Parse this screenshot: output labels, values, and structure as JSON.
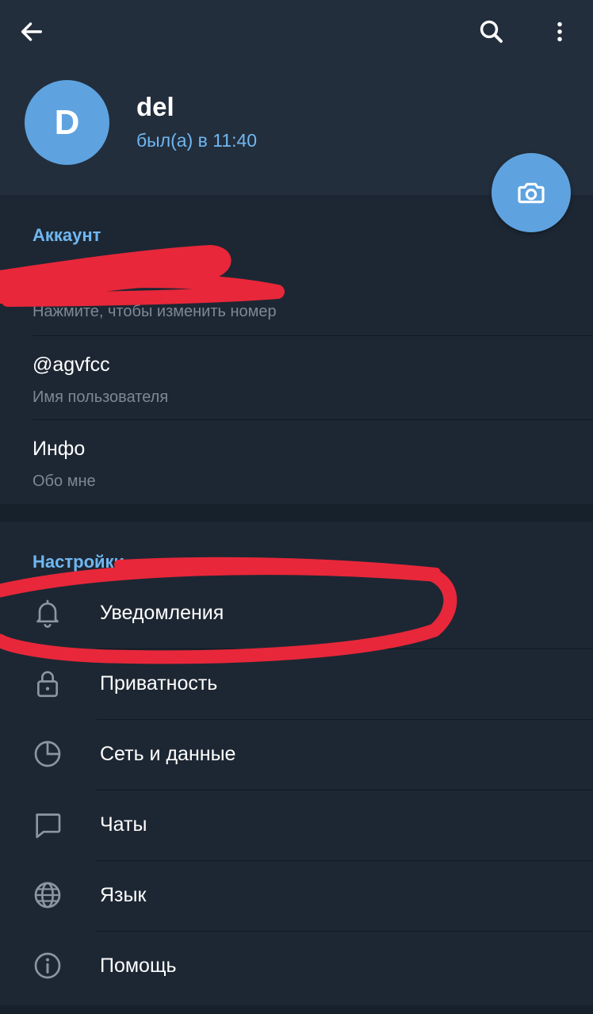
{
  "header": {
    "back_icon": "arrow-left-icon",
    "search_icon": "search-icon",
    "more_icon": "more-vertical-icon"
  },
  "profile": {
    "avatar_letter": "D",
    "name": "del",
    "status": "был(а) в 11:40",
    "camera_icon": "camera-icon"
  },
  "account": {
    "title": "Аккаунт",
    "phone_hint": "Нажмите, чтобы изменить номер",
    "username": "@agvfcc",
    "username_hint": "Имя пользователя",
    "bio": "Инфо",
    "bio_hint": "Обо мне"
  },
  "settings": {
    "title": "Настройки",
    "items": [
      {
        "label": "Уведомления",
        "icon": "bell-icon"
      },
      {
        "label": "Приватность",
        "icon": "lock-icon"
      },
      {
        "label": "Сеть и данные",
        "icon": "pie-chart-icon"
      },
      {
        "label": "Чаты",
        "icon": "chat-bubble-icon"
      },
      {
        "label": "Язык",
        "icon": "globe-icon"
      },
      {
        "label": "Помощь",
        "icon": "info-icon"
      }
    ]
  },
  "colors": {
    "background": "#17212b",
    "header": "#232e3c",
    "section": "#1d2733",
    "accent": "#6fb7f2",
    "avatar": "#5ea3e0",
    "annotation": "#e8273a"
  }
}
